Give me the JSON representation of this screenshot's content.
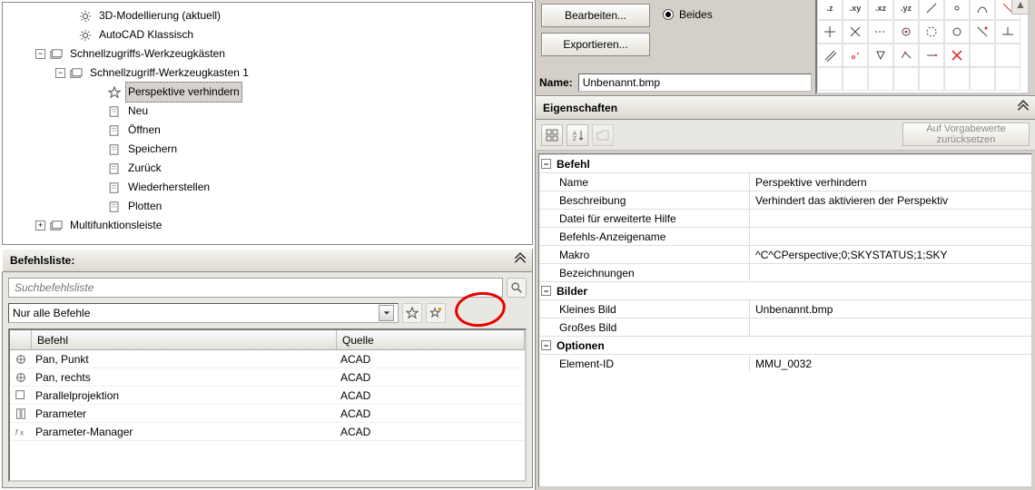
{
  "tree": {
    "items": [
      {
        "indent": 64,
        "exp": "",
        "icon": "gear",
        "label": "3D-Modellierung (aktuell)",
        "sel": false
      },
      {
        "indent": 64,
        "exp": "",
        "icon": "gear",
        "label": "AutoCAD Klassisch",
        "sel": false
      },
      {
        "indent": 32,
        "exp": "-",
        "icon": "box",
        "label": "Schnellzugriffs-Werkzeugkästen",
        "sel": false
      },
      {
        "indent": 54,
        "exp": "-",
        "icon": "box",
        "label": "Schnellzugriff-Werkzeugkasten 1",
        "sel": false
      },
      {
        "indent": 96,
        "exp": "",
        "icon": "star",
        "label": "Perspektive verhindern",
        "sel": true
      },
      {
        "indent": 96,
        "exp": "",
        "icon": "doc",
        "label": "Neu",
        "sel": false
      },
      {
        "indent": 96,
        "exp": "",
        "icon": "doc",
        "label": "Öffnen",
        "sel": false
      },
      {
        "indent": 96,
        "exp": "",
        "icon": "doc",
        "label": "Speichern",
        "sel": false
      },
      {
        "indent": 96,
        "exp": "",
        "icon": "doc",
        "label": "Zurück",
        "sel": false
      },
      {
        "indent": 96,
        "exp": "",
        "icon": "doc",
        "label": "Wiederherstellen",
        "sel": false
      },
      {
        "indent": 96,
        "exp": "",
        "icon": "doc",
        "label": "Plotten",
        "sel": false
      },
      {
        "indent": 32,
        "exp": "+",
        "icon": "box",
        "label": "Multifunktionsleiste",
        "sel": false
      }
    ]
  },
  "cmdlist": {
    "title": "Befehlsliste:",
    "search_placeholder": "Suchbefehlsliste",
    "filter_value": "Nur alle Befehle",
    "col_icon": "",
    "col_cmd": "Befehl",
    "col_src": "Quelle",
    "rows": [
      {
        "icon": "pan",
        "cmd": "Pan, Punkt",
        "src": "ACAD"
      },
      {
        "icon": "pan",
        "cmd": "Pan, rechts",
        "src": "ACAD"
      },
      {
        "icon": "proj",
        "cmd": "Parallelprojektion",
        "src": "ACAD"
      },
      {
        "icon": "param",
        "cmd": "Parameter",
        "src": "ACAD"
      },
      {
        "icon": "fx",
        "cmd": "Parameter-Manager",
        "src": "ACAD"
      }
    ]
  },
  "topright": {
    "edit_btn": "Bearbeiten...",
    "export_btn": "Exportieren...",
    "radio_both": "Beides",
    "name_lbl": "Name:",
    "name_val": "Unbenannt.bmp",
    "pal_labels": [
      ".z",
      ".xy",
      ".xz",
      ".yz"
    ]
  },
  "eigenschaften": {
    "title": "Eigenschaften",
    "reset": "Auf Vorgabewerte zurücksetzen",
    "groups": [
      {
        "name": "Befehl",
        "rows": [
          {
            "k": "Name",
            "v": "Perspektive verhindern"
          },
          {
            "k": "Beschreibung",
            "v": "Verhindert das aktivieren der Perspektiv"
          },
          {
            "k": "Datei für erweiterte Hilfe",
            "v": ""
          },
          {
            "k": "Befehls-Anzeigename",
            "v": ""
          },
          {
            "k": "Makro",
            "v": "^C^CPerspective;0;SKYSTATUS;1;SKY"
          },
          {
            "k": "Bezeichnungen",
            "v": ""
          }
        ]
      },
      {
        "name": "Bilder",
        "rows": [
          {
            "k": "Kleines Bild",
            "v": "Unbenannt.bmp"
          },
          {
            "k": "Großes Bild",
            "v": ""
          }
        ]
      },
      {
        "name": "Optionen",
        "rows": [
          {
            "k": "Element-ID",
            "v": "MMU_0032"
          }
        ]
      }
    ]
  }
}
